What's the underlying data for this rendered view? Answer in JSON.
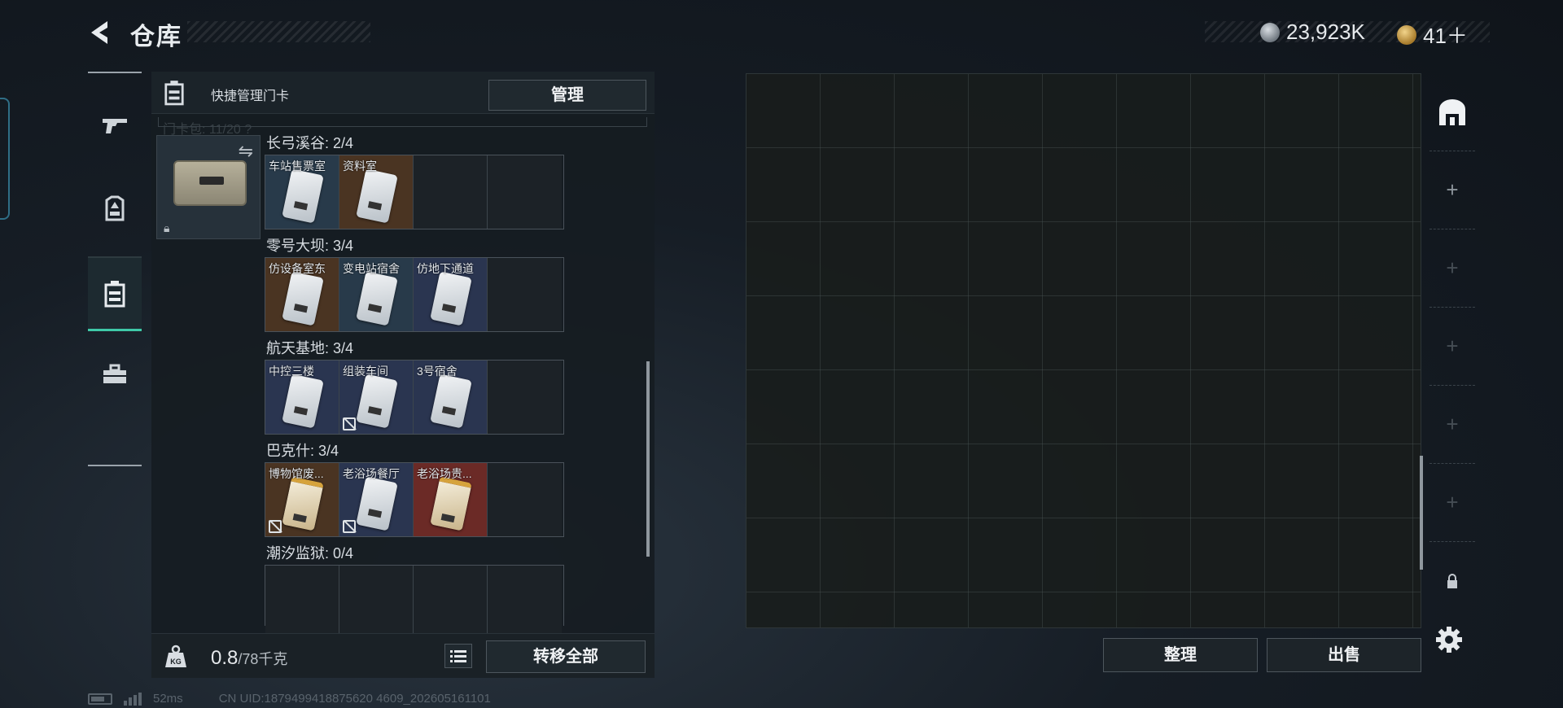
{
  "header": {
    "title": "仓库"
  },
  "currency": {
    "silver": "23,923K",
    "gold": "41＋"
  },
  "manage_panel": {
    "title": "快捷管理门卡",
    "manage_label": "管理",
    "ghost_text": "门卡包: 11/20 ?"
  },
  "regions": [
    {
      "label": "长弓溪谷: 2/4",
      "slots": [
        {
          "name": "车站售票室",
          "color": "blue",
          "card": "silver",
          "nolink": false
        },
        {
          "name": "资料室",
          "color": "brown",
          "card": "silver",
          "nolink": false
        },
        {
          "name": "",
          "color": "empty"
        },
        {
          "name": "",
          "color": "empty"
        }
      ]
    },
    {
      "label": "零号大坝: 3/4",
      "slots": [
        {
          "name": "仿设备室东",
          "color": "brown",
          "card": "silver",
          "nolink": false
        },
        {
          "name": "变电站宿舍",
          "color": "blue",
          "card": "silver",
          "nolink": false
        },
        {
          "name": "仿地下通道",
          "color": "navy",
          "card": "silver",
          "nolink": false
        },
        {
          "name": "",
          "color": "empty"
        }
      ]
    },
    {
      "label": "航天基地: 3/4",
      "slots": [
        {
          "name": "中控三楼",
          "color": "navy",
          "card": "silver",
          "nolink": false
        },
        {
          "name": "组装车间",
          "color": "navy",
          "card": "silver",
          "nolink": true
        },
        {
          "name": "3号宿舍",
          "color": "navy",
          "card": "silver",
          "nolink": false
        },
        {
          "name": "",
          "color": "empty"
        }
      ]
    },
    {
      "label": "巴克什: 3/4",
      "slots": [
        {
          "name": "博物馆废...",
          "color": "brown",
          "card": "gold",
          "nolink": true
        },
        {
          "name": "老浴场餐厅",
          "color": "navy",
          "card": "silver",
          "nolink": true
        },
        {
          "name": "老浴场贵...",
          "color": "red",
          "card": "gold",
          "nolink": false
        },
        {
          "name": "",
          "color": "empty"
        }
      ]
    },
    {
      "label": "潮汐监狱: 0/4",
      "slots": [
        {
          "name": "",
          "color": "empty"
        },
        {
          "name": "",
          "color": "empty"
        },
        {
          "name": "",
          "color": "empty"
        },
        {
          "name": "",
          "color": "empty"
        }
      ]
    }
  ],
  "footer": {
    "weight": "0.8",
    "weight_max": "/78千克",
    "transfer_label": "转移全部",
    "kg_badge": "KG"
  },
  "actions": {
    "sort_label": "整理",
    "sell_label": "出售"
  },
  "side_column": [
    {
      "icon": "stash-icon",
      "glyph": ""
    },
    {
      "icon": "plus-icon",
      "glyph": "+"
    },
    {
      "icon": "plus-icon",
      "glyph": "+"
    },
    {
      "icon": "plus-icon",
      "glyph": "+"
    },
    {
      "icon": "plus-icon",
      "glyph": "+"
    },
    {
      "icon": "plus-icon",
      "glyph": "+"
    },
    {
      "icon": "lock-icon",
      "glyph": "🔒"
    }
  ],
  "status": {
    "ping": "52ms",
    "uid": "CN UID:1879499418875620 4609_202605161101"
  },
  "colors": {
    "accent": "#3fc9a8",
    "background": "#161d25"
  }
}
